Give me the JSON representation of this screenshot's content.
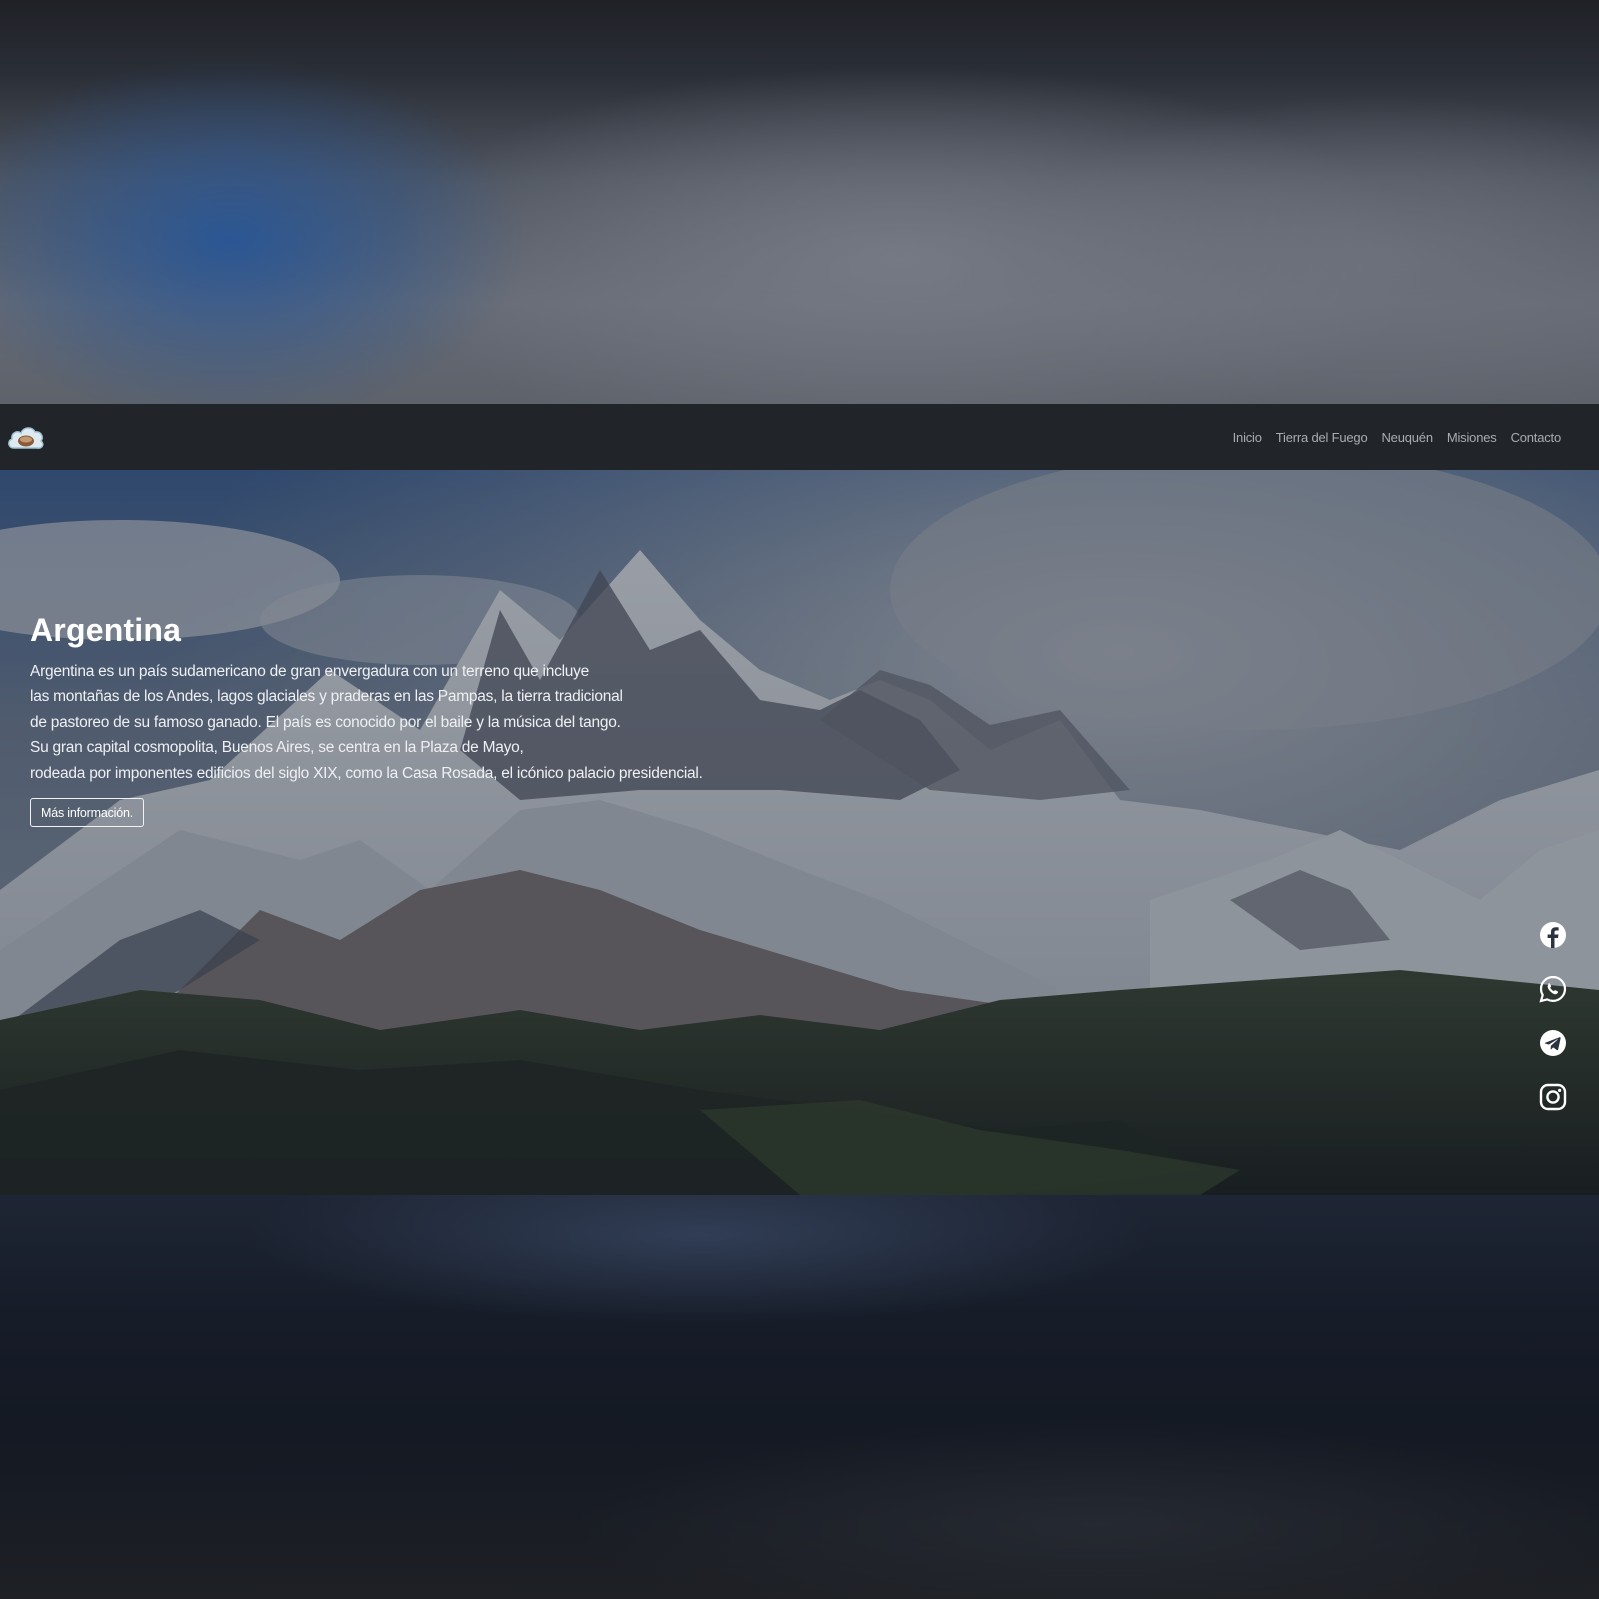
{
  "navbar": {
    "logo_icon": "cloud-logo-icon",
    "links": [
      {
        "label": "Inicio"
      },
      {
        "label": "Tierra del Fuego"
      },
      {
        "label": "Neuquén"
      },
      {
        "label": "Misiones"
      },
      {
        "label": "Contacto"
      }
    ]
  },
  "hero": {
    "title": "Argentina",
    "lines": [
      "Argentina es un país sudamericano de gran envergadura con un terreno que incluye",
      "las montañas de los Andes, lagos glaciales y praderas en las Pampas, la tierra tradicional",
      "de pastoreo de su famoso ganado. El país es conocido por el baile y la música del tango.",
      "Su gran capital cosmopolita, Buenos Aires, se centra en la Plaza de Mayo,",
      "rodeada por imponentes edificios del siglo XIX, como la Casa Rosada, el icónico palacio presidencial."
    ],
    "button_label": "Más información."
  },
  "social": {
    "icons": [
      "facebook-icon",
      "whatsapp-icon",
      "telegram-icon",
      "instagram-icon"
    ]
  },
  "colors": {
    "navbar_bg": "#212429",
    "nav_link": "#a9adb3",
    "text": "#ffffff"
  }
}
